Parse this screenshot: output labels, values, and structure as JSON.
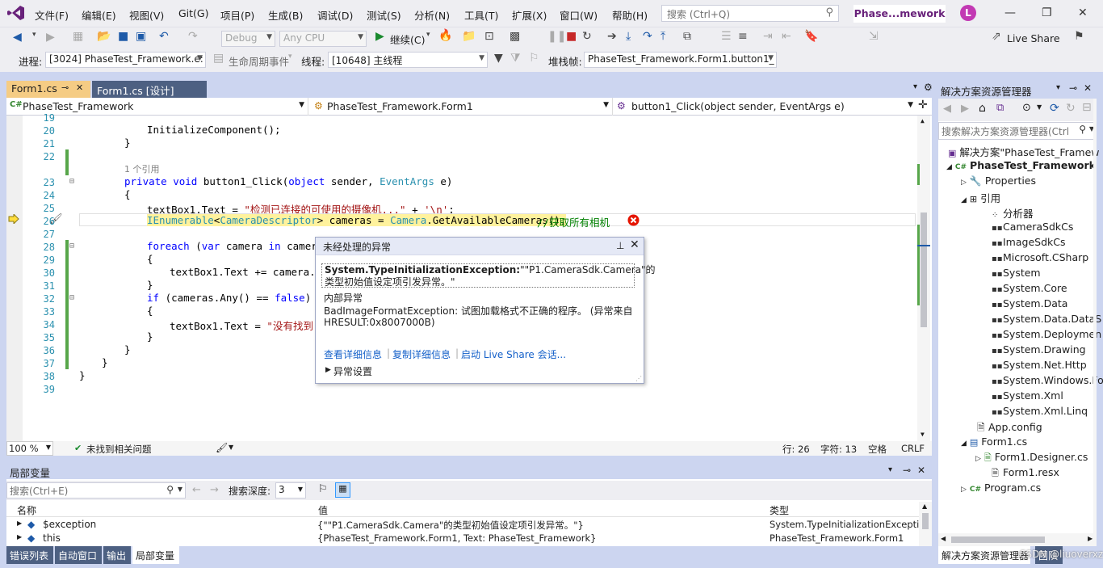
{
  "menu": [
    "文件(F)",
    "编辑(E)",
    "视图(V)",
    "Git(G)",
    "项目(P)",
    "生成(B)",
    "调试(D)",
    "测试(S)",
    "分析(N)",
    "工具(T)",
    "扩展(X)",
    "窗口(W)",
    "帮助(H)"
  ],
  "search": {
    "placeholder": "搜索 (Ctrl+Q)"
  },
  "title_badge": "Phase...mework",
  "avatar_letter": "L",
  "toolbar1": {
    "config": "Debug",
    "platform": "Any CPU",
    "continue_label": "继续(C)",
    "live_share": "Live Share"
  },
  "toolbar2": {
    "process_label": "进程:",
    "process_value": "[3024] PhaseTest_Framework.e:",
    "lifecycle_label": "生命周期事件",
    "thread_label": "线程:",
    "thread_value": "[10648] 主线程",
    "stackframe_label": "堆栈帧:",
    "stackframe_value": "PhaseTest_Framework.Form1.button1_"
  },
  "tabs": {
    "form1cs": "Form1.cs",
    "form1design": "Form1.cs [设计]"
  },
  "navbar": {
    "project": "PhaseTest_Framework",
    "class": "PhaseTest_Framework.Form1",
    "member": "button1_Click(object sender, EventArgs e)"
  },
  "code": {
    "line_numbers": [
      "19",
      "20",
      "21",
      "22",
      "",
      "23",
      "24",
      "25",
      "26",
      "27",
      "28",
      "29",
      "30",
      "31",
      "32",
      "33",
      "34",
      "35",
      "36",
      "37",
      "38",
      "39"
    ],
    "l20": "InitializeComponent();",
    "l21": "}",
    "refcount": "1 个引用",
    "l23_kw1": "private void ",
    "l23_name": "button1_Click",
    "l23_rest1": "(",
    "l23_kw2": "object",
    "l23_rest2": " sender, ",
    "l23_ty": "EventArgs",
    "l23_rest3": " e)",
    "l24": "{",
    "l25_a": "textBox1.Text = ",
    "l25_str": "\"检测已连接的可使用的摄像机...\"",
    "l25_b": " + ",
    "l25_chr": "'\\n'",
    "l25_c": ";",
    "l26_ty1": "IEnumerable",
    "l26_b": "<",
    "l26_ty2": "CameraDescriptor",
    "l26_c": "> cameras = ",
    "l26_ty3": "Camera",
    "l26_d": ".GetAvailableCameras();",
    "l26_cm": "//获取所有相机",
    "l28_kw": "foreach",
    "l28_a": " (",
    "l28_kw2": "var",
    "l28_b": " camera ",
    "l28_kw3": "in",
    "l28_c": " cameras",
    "l29": "{",
    "l30": "textBox1.Text += camera.To",
    "l31": "}",
    "l32_kw": "if",
    "l32_a": " (cameras.",
    "l32_any": "Any",
    "l32_b": "() == ",
    "l32_kw2": "false",
    "l32_c": ")",
    "l33": "{",
    "l34_a": "textBox1.Text = ",
    "l34_str": "\"没有找到",
    "l35": "}",
    "l36": "}",
    "l37": "}",
    "l38": "}"
  },
  "exception": {
    "title": "未经处理的异常",
    "type": "System.TypeInitializationException:",
    "message_a": "\"\"P1.CameraSdk.Camera\"的",
    "message_b": "类型初始值设定项引发异常。\"",
    "inner_label": "内部异常",
    "inner_msg_a": "BadImageFormatException: 试图加载格式不正确的程序。 (异常来自",
    "inner_msg_b": "HRESULT:0x8007000B)",
    "link_details": "查看详细信息",
    "link_copy": "复制详细信息",
    "link_liveshare": "启动 Live Share 会话...",
    "settings": "异常设置"
  },
  "editor_status": {
    "zoom": "100 %",
    "issues": "未找到相关问题",
    "line": "行: 26",
    "char": "字符: 13",
    "space": "空格",
    "eol": "CRLF"
  },
  "locals": {
    "title": "局部变量",
    "search_placeholder": "搜索(Ctrl+E)",
    "depth_label": "搜索深度:",
    "depth_value": "3",
    "columns": [
      "名称",
      "值",
      "类型"
    ],
    "rows": [
      {
        "name": "$exception",
        "value": "{\"\"P1.CameraSdk.Camera\"的类型初始值设定项引发异常。\"}",
        "type": "System.TypeInitializationException"
      },
      {
        "name": "this",
        "value": "{PhaseTest_Framework.Form1, Text: PhaseTest_Framework}",
        "type": "PhaseTest_Framework.Form1"
      }
    ]
  },
  "bottom_tabs": [
    "错误列表",
    "自动窗口",
    "输出",
    "局部变量"
  ],
  "solution_explorer": {
    "title": "解决方案资源管理器",
    "search_placeholder": "搜索解决方案资源管理器(Ctrl",
    "items": [
      {
        "label": "解决方案\"PhaseTest_Framew"
      },
      {
        "label": "PhaseTest_Framework"
      },
      {
        "label": "Properties"
      },
      {
        "label": "引用"
      },
      {
        "label": "分析器"
      },
      {
        "label": "CameraSdkCs"
      },
      {
        "label": "ImageSdkCs"
      },
      {
        "label": "Microsoft.CSharp"
      },
      {
        "label": "System"
      },
      {
        "label": "System.Core"
      },
      {
        "label": "System.Data"
      },
      {
        "label": "System.Data.DataS"
      },
      {
        "label": "System.Deploymen"
      },
      {
        "label": "System.Drawing"
      },
      {
        "label": "System.Net.Http"
      },
      {
        "label": "System.Windows.Fo"
      },
      {
        "label": "System.Xml"
      },
      {
        "label": "System.Xml.Linq"
      },
      {
        "label": "App.config"
      },
      {
        "label": "Form1.cs"
      },
      {
        "label": "Form1.Designer.cs"
      },
      {
        "label": "Form1.resx"
      },
      {
        "label": "Program.cs"
      }
    ],
    "bottom_tabs": [
      "解决方案资源管理器",
      "团队"
    ],
    "watermark": "CSDN @liuoverxz"
  }
}
